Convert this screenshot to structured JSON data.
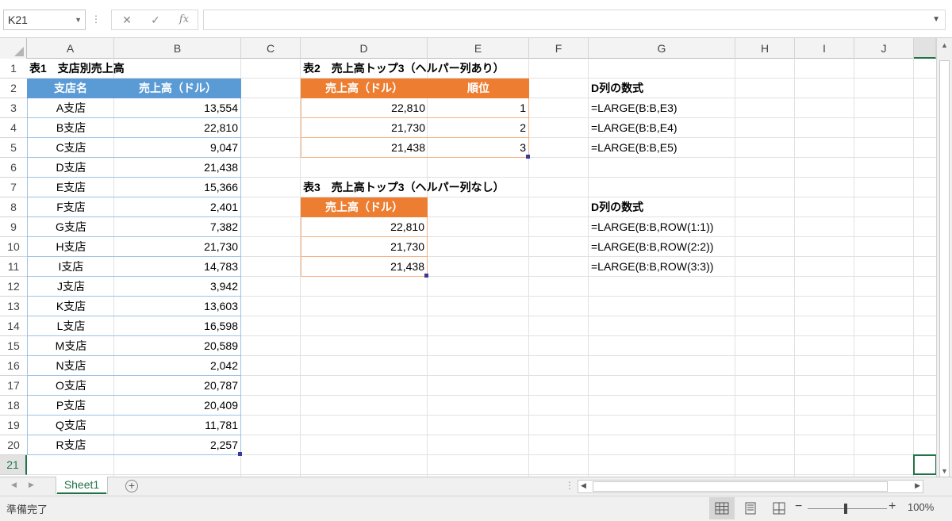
{
  "formula_bar": {
    "name_box": "K21",
    "cancel_icon": "✕",
    "enter_icon": "✓",
    "function_icon": "fx",
    "formula": ""
  },
  "columns": [
    "A",
    "B",
    "C",
    "D",
    "E",
    "F",
    "G",
    "H",
    "I",
    "J"
  ],
  "rows": [
    "1",
    "2",
    "3",
    "4",
    "5",
    "6",
    "7",
    "8",
    "9",
    "10",
    "11",
    "12",
    "13",
    "14",
    "15",
    "16",
    "17",
    "18",
    "19",
    "20",
    "21"
  ],
  "table1": {
    "title": "表1　支店別売上高",
    "headers": [
      "支店名",
      "売上高（ドル）"
    ],
    "rows": [
      [
        "A支店",
        "13,554"
      ],
      [
        "B支店",
        "22,810"
      ],
      [
        "C支店",
        "9,047"
      ],
      [
        "D支店",
        "21,438"
      ],
      [
        "E支店",
        "15,366"
      ],
      [
        "F支店",
        "2,401"
      ],
      [
        "G支店",
        "7,382"
      ],
      [
        "H支店",
        "21,730"
      ],
      [
        "I支店",
        "14,783"
      ],
      [
        "J支店",
        "3,942"
      ],
      [
        "K支店",
        "13,603"
      ],
      [
        "L支店",
        "16,598"
      ],
      [
        "M支店",
        "20,589"
      ],
      [
        "N支店",
        "2,042"
      ],
      [
        "O支店",
        "20,787"
      ],
      [
        "P支店",
        "20,409"
      ],
      [
        "Q支店",
        "11,781"
      ],
      [
        "R支店",
        "2,257"
      ]
    ]
  },
  "table2": {
    "title": "表2　売上高トップ3（ヘルパー列あり）",
    "headers": [
      "売上高（ドル）",
      "順位"
    ],
    "rows": [
      [
        "22,810",
        "1"
      ],
      [
        "21,730",
        "2"
      ],
      [
        "21,438",
        "3"
      ]
    ],
    "formula_label": "D列の数式",
    "formulas": [
      "=LARGE(B:B,E3)",
      "=LARGE(B:B,E4)",
      "=LARGE(B:B,E5)"
    ]
  },
  "table3": {
    "title": "表3　売上高トップ3（ヘルパー列なし）",
    "headers": [
      "売上高（ドル）"
    ],
    "rows": [
      [
        "22,810"
      ],
      [
        "21,730"
      ],
      [
        "21,438"
      ]
    ],
    "formula_label": "D列の数式",
    "formulas": [
      "=LARGE(B:B,ROW(1:1))",
      "=LARGE(B:B,ROW(2:2))",
      "=LARGE(B:B,ROW(3:3))"
    ]
  },
  "tabs": {
    "sheet_name": "Sheet1",
    "add_sheet": "+"
  },
  "status": {
    "ready": "準備完了",
    "zoom_minus": "−",
    "zoom_plus": "+",
    "zoom": "100%"
  },
  "colors": {
    "accent_green": "#217346",
    "header_blue": "#5b9bd5",
    "header_orange": "#ed7d31"
  }
}
